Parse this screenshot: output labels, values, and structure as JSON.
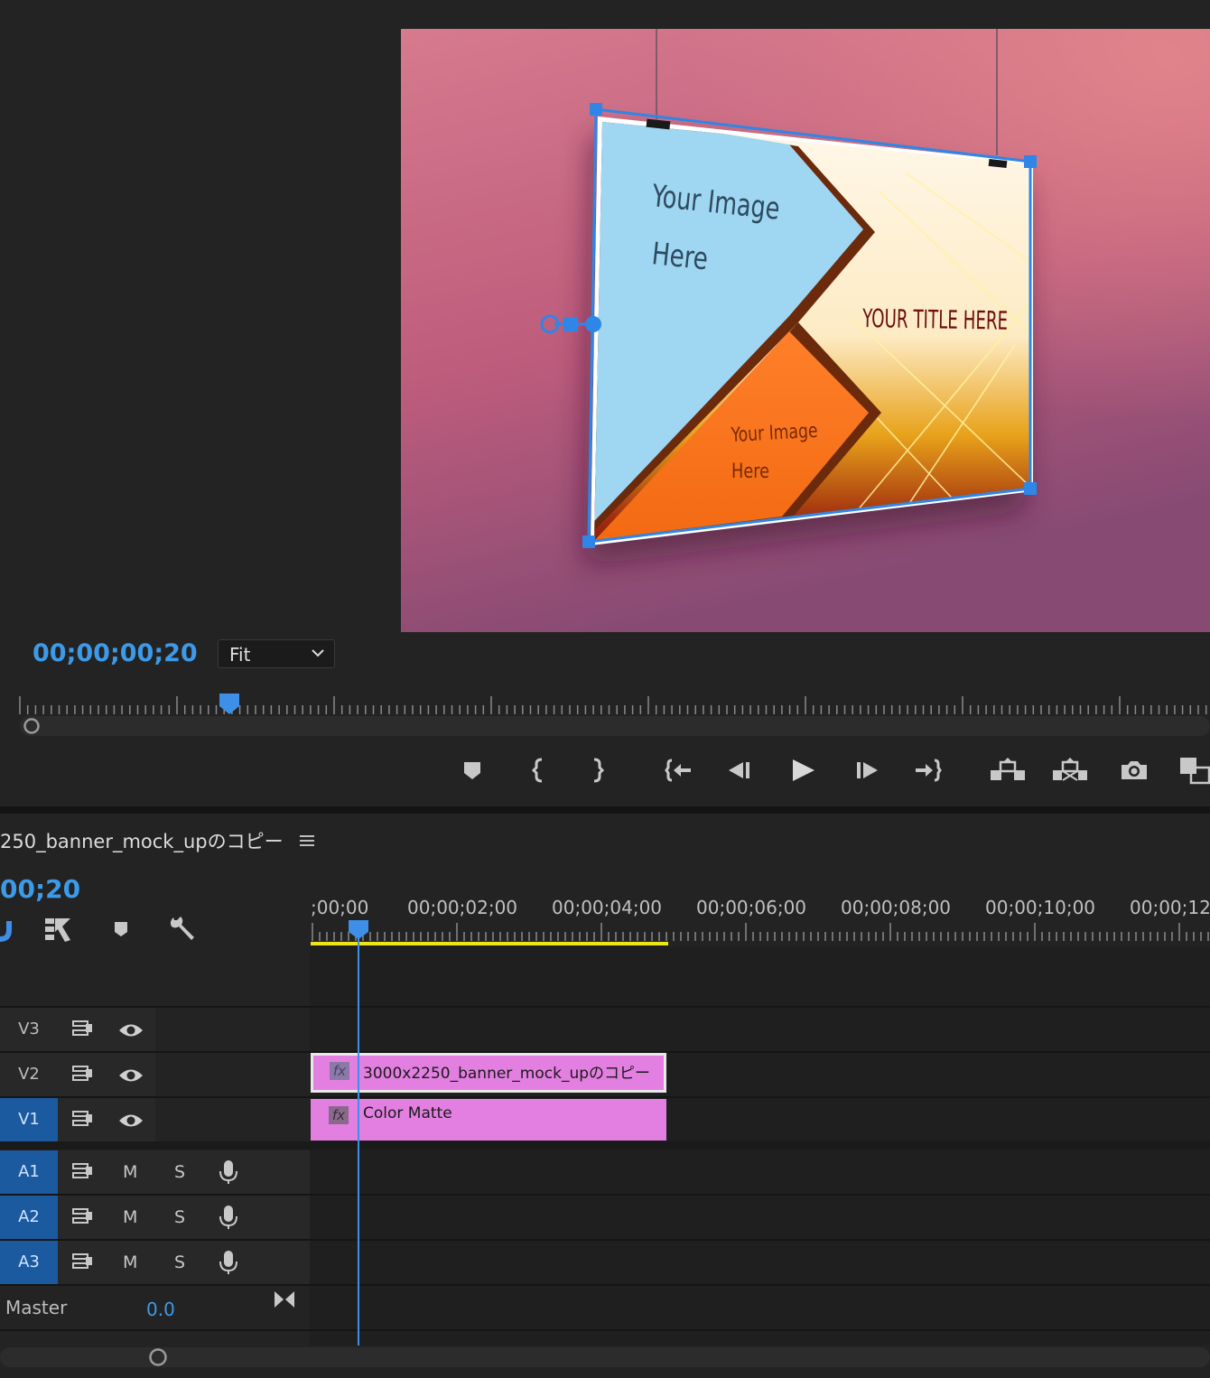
{
  "monitor": {
    "timecode": "00;00;00;20",
    "zoom": "Fit",
    "banner": {
      "left_text_line1": "Your Image",
      "left_text_line2": "Here",
      "title": "YOUR TITLE HERE",
      "bottom_text_line1": "Your Image",
      "bottom_text_line2": "Here"
    },
    "controls": [
      {
        "name": "add-marker-button",
        "icon": "marker-icon"
      },
      {
        "name": "mark-in-button",
        "icon": "mark-in-icon"
      },
      {
        "name": "mark-out-button",
        "icon": "mark-out-icon"
      },
      {
        "name": "go-to-in-button",
        "icon": "go-to-in-icon"
      },
      {
        "name": "step-back-button",
        "icon": "step-back-icon"
      },
      {
        "name": "play-button",
        "icon": "play-icon"
      },
      {
        "name": "step-forward-button",
        "icon": "step-forward-icon"
      },
      {
        "name": "go-to-out-button",
        "icon": "go-to-out-icon"
      },
      {
        "name": "lift-button",
        "icon": "lift-icon"
      },
      {
        "name": "extract-button",
        "icon": "extract-icon"
      },
      {
        "name": "export-frame-button",
        "icon": "camera-icon"
      },
      {
        "name": "compare-view-button",
        "icon": "compare-icon"
      }
    ]
  },
  "timeline": {
    "sequence_name": "250_banner_mock_upのコピー",
    "timecode": "00;20",
    "ruler_labels": [
      ";00;00",
      "00;00;02;00",
      "00;00;04;00",
      "00;00;06;00",
      "00;00;08;00",
      "00;00;10;00",
      "00;00;12;"
    ],
    "tracks": {
      "video": [
        {
          "id": "V3",
          "targeted": false
        },
        {
          "id": "V2",
          "targeted": false
        },
        {
          "id": "V1",
          "targeted": true
        }
      ],
      "audio": [
        {
          "id": "A1",
          "mute": "M",
          "solo": "S"
        },
        {
          "id": "A2",
          "mute": "M",
          "solo": "S"
        },
        {
          "id": "A3",
          "mute": "M",
          "solo": "S"
        }
      ]
    },
    "clips": [
      {
        "track": "V2",
        "label": "3000x2250_banner_mock_upのコピー",
        "fx": "fx"
      },
      {
        "track": "V1",
        "label": "Color Matte",
        "fx": "fx"
      }
    ],
    "master": {
      "label": "Master",
      "value": "0.0"
    }
  },
  "colors": {
    "accent_blue": "#3d9ae8",
    "clip_pink": "#e27fe0",
    "work_area_yellow": "#f0e518"
  }
}
